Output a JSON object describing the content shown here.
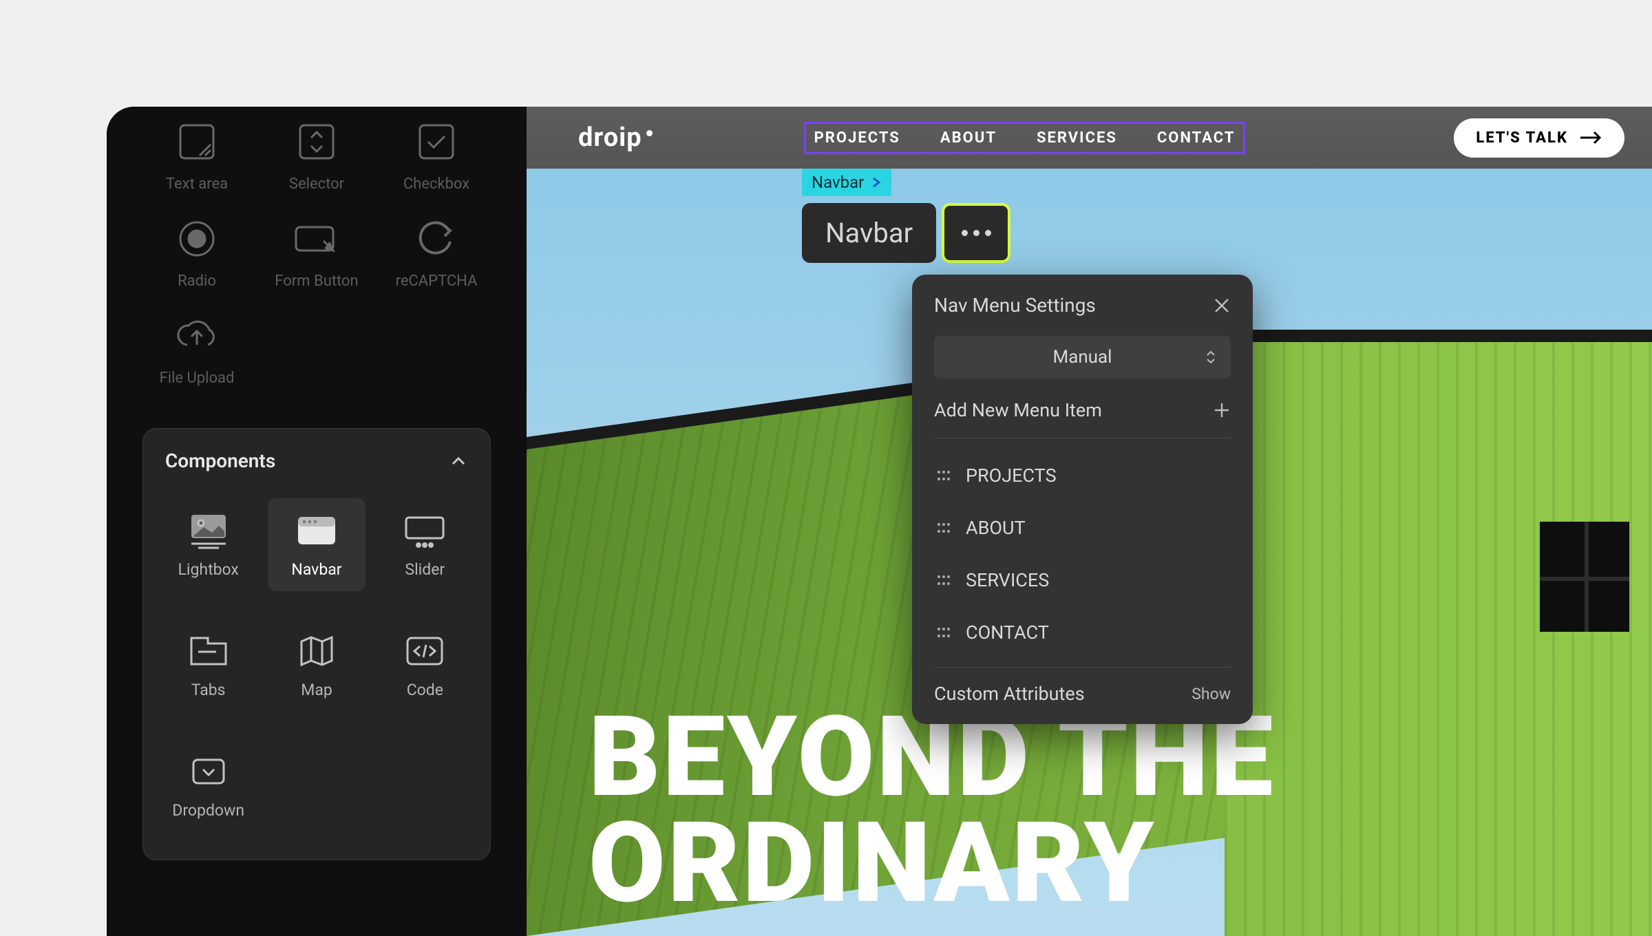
{
  "sidebar": {
    "form_widgets": [
      {
        "label": "Text area",
        "icon": "textarea-icon"
      },
      {
        "label": "Selector",
        "icon": "selector-icon"
      },
      {
        "label": "Checkbox",
        "icon": "checkbox-icon"
      },
      {
        "label": "Radio",
        "icon": "radio-icon"
      },
      {
        "label": "Form Button",
        "icon": "form-button-icon"
      },
      {
        "label": "reCAPTCHA",
        "icon": "recaptcha-icon"
      },
      {
        "label": "File Upload",
        "icon": "file-upload-icon"
      }
    ],
    "components_title": "Components",
    "components": [
      {
        "label": "Lightbox",
        "icon": "lightbox-icon",
        "selected": false
      },
      {
        "label": "Navbar",
        "icon": "navbar-icon",
        "selected": true
      },
      {
        "label": "Slider",
        "icon": "slider-icon",
        "selected": false
      },
      {
        "label": "Tabs",
        "icon": "tabs-icon",
        "selected": false
      },
      {
        "label": "Map",
        "icon": "map-icon",
        "selected": false
      },
      {
        "label": "Code",
        "icon": "code-icon",
        "selected": false
      },
      {
        "label": "Dropdown",
        "icon": "dropdown-icon",
        "selected": false
      }
    ]
  },
  "canvas": {
    "logo": "droip",
    "nav_items": [
      "PROJECTS",
      "ABOUT",
      "SERVICES",
      "CONTACT"
    ],
    "cta_label": "LET'S TALK",
    "hero_line1": "BEYOND THE",
    "hero_line2": "ORDINARY",
    "selection_tag": "Navbar",
    "selection_chip": "Navbar"
  },
  "settings_panel": {
    "title": "Nav Menu Settings",
    "mode_select_value": "Manual",
    "add_label": "Add New Menu Item",
    "menu_items": [
      "PROJECTS",
      "ABOUT",
      "SERVICES",
      "CONTACT"
    ],
    "custom_attributes_label": "Custom Attributes",
    "show_label": "Show"
  },
  "colors": {
    "accent_purple": "#7b3fff",
    "accent_cyan": "#2ad4e0",
    "accent_lime": "#d7ff3a"
  }
}
